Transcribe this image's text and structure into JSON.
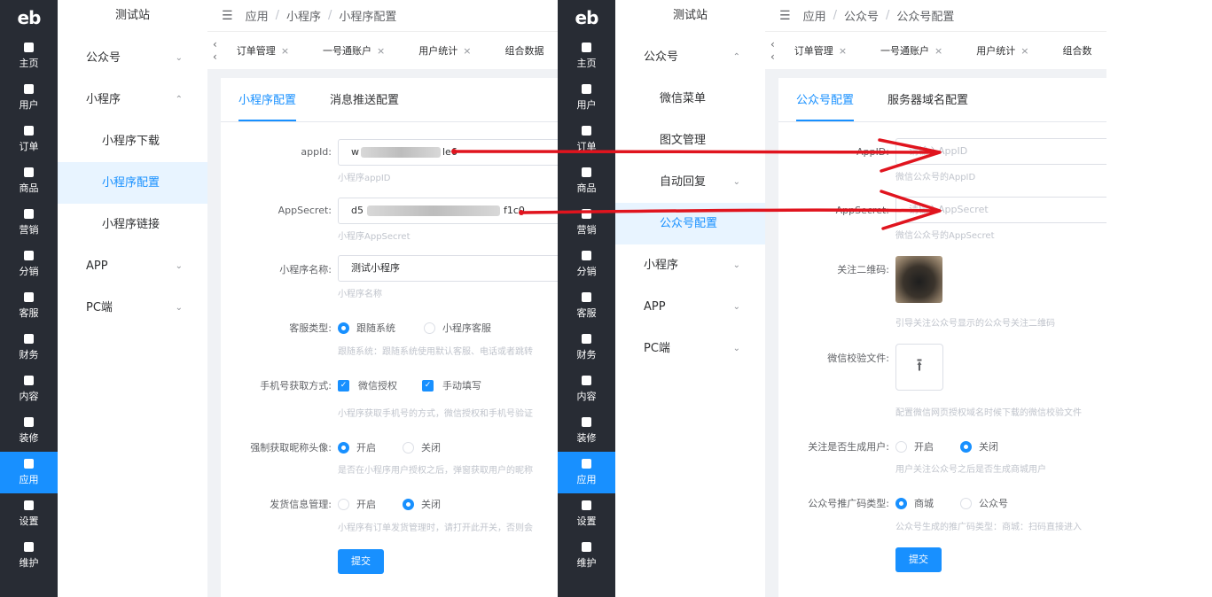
{
  "left": {
    "site": "测试站",
    "rail": [
      "主页",
      "用户",
      "订单",
      "商品",
      "营销",
      "分销",
      "客服",
      "财务",
      "内容",
      "装修",
      "应用",
      "设置",
      "维护"
    ],
    "menu": [
      {
        "label": "公众号",
        "chev": "⌄"
      },
      {
        "label": "小程序",
        "chev": "⌃"
      },
      {
        "label": "小程序下载",
        "chev": ""
      },
      {
        "label": "小程序配置",
        "chev": ""
      },
      {
        "label": "小程序链接",
        "chev": ""
      },
      {
        "label": "APP",
        "chev": "⌄"
      },
      {
        "label": "PC端",
        "chev": "⌄"
      }
    ],
    "breadcrumb": [
      "应用",
      "小程序",
      "小程序配置"
    ],
    "tabs": [
      "订单管理",
      "一号通账户",
      "用户统计",
      "组合数据"
    ],
    "card_tabs": [
      "小程序配置",
      "消息推送配置"
    ],
    "form": {
      "appid_label": "appId:",
      "appid_prefix": "w",
      "appid_suffix": "le6",
      "appid_tip": "小程序appID",
      "secret_label": "AppSecret:",
      "secret_prefix": "d5",
      "secret_suffix": "f1c0",
      "secret_tip": "小程序AppSecret",
      "name_label": "小程序名称:",
      "name_value": "测试小程序",
      "name_tip": "小程序名称",
      "cs_label": "客服类型:",
      "cs_opt1": "跟随系统",
      "cs_opt2": "小程序客服",
      "cs_tip": "跟随系统：跟随系统使用默认客服、电话或者跳转",
      "phone_label": "手机号获取方式:",
      "phone_opt1": "微信授权",
      "phone_opt2": "手动填写",
      "phone_tip": "小程序获取手机号的方式，微信授权和手机号验证",
      "avatar_label": "强制获取昵称头像:",
      "avatar_opt1": "开启",
      "avatar_opt2": "关闭",
      "avatar_tip": "是否在小程序用户授权之后，弹窗获取用户的昵称",
      "ship_label": "发货信息管理:",
      "ship_opt1": "开启",
      "ship_opt2": "关闭",
      "ship_tip": "小程序有订单发货管理时，请打开此开关，否则会",
      "submit": "提交"
    }
  },
  "right": {
    "site": "测试站",
    "rail": [
      "主页",
      "用户",
      "订单",
      "商品",
      "营销",
      "分销",
      "客服",
      "财务",
      "内容",
      "装修",
      "应用",
      "设置",
      "维护"
    ],
    "menu": [
      {
        "label": "公众号",
        "chev": "⌃"
      },
      {
        "label": "微信菜单",
        "chev": ""
      },
      {
        "label": "图文管理",
        "chev": ""
      },
      {
        "label": "自动回复",
        "chev": "⌄"
      },
      {
        "label": "公众号配置",
        "chev": ""
      },
      {
        "label": "小程序",
        "chev": "⌄"
      },
      {
        "label": "APP",
        "chev": "⌄"
      },
      {
        "label": "PC端",
        "chev": "⌄"
      }
    ],
    "breadcrumb": [
      "应用",
      "公众号",
      "公众号配置"
    ],
    "tabs": [
      "订单管理",
      "一号通账户",
      "用户统计",
      "组合数"
    ],
    "card_tabs": [
      "公众号配置",
      "服务器域名配置"
    ],
    "form": {
      "appid_label": "AppID:",
      "appid_placeholder": "请输入AppID",
      "appid_tip": "微信公众号的AppID",
      "secret_label": "AppSecret:",
      "secret_placeholder": "请输入AppSecret",
      "secret_tip": "微信公众号的AppSecret",
      "qr_label": "关注二维码:",
      "qr_tip": "引导关注公众号显示的公众号关注二维码",
      "file_label": "微信校验文件:",
      "file_tip": "配置微信网页授权域名时候下载的微信校验文件",
      "gen_label": "关注是否生成用户:",
      "gen_opt1": "开启",
      "gen_opt2": "关闭",
      "gen_tip": "用户关注公众号之后是否生成商城用户",
      "promo_label": "公众号推广码类型:",
      "promo_opt1": "商城",
      "promo_opt2": "公众号",
      "promo_tip": "公众号生成的推广码类型：商城：扫码直接进入",
      "submit": "提交"
    }
  },
  "logo": "eb",
  "colors": {
    "accent": "#1890ff",
    "rail": "#282c34",
    "arrow": "#e0141e"
  }
}
